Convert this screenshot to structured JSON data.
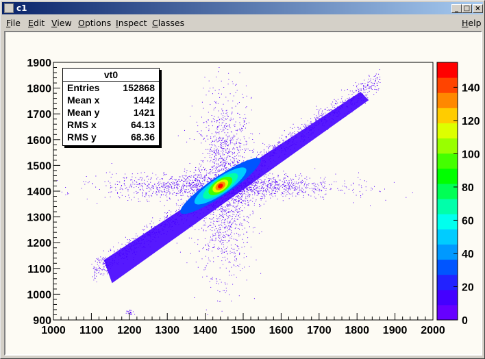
{
  "window": {
    "title": "c1",
    "buttons": {
      "minimize": "_",
      "maximize": "□",
      "close": "×"
    }
  },
  "menu": {
    "items": [
      "File",
      "Edit",
      "View",
      "Options",
      "Inspect",
      "Classes"
    ],
    "help": "Help"
  },
  "stats": {
    "title": "vt0",
    "rows": [
      {
        "label": "Entries",
        "value": "152868"
      },
      {
        "label": "Mean x",
        "value": "1442"
      },
      {
        "label": "Mean y",
        "value": "1421"
      },
      {
        "label": "RMS x",
        "value": "64.13"
      },
      {
        "label": "RMS y",
        "value": "68.36"
      }
    ]
  },
  "colors": {
    "palette": [
      "#6600ff",
      "#4400ff",
      "#2222ff",
      "#0055ff",
      "#0099ff",
      "#00ccff",
      "#00ffee",
      "#00ffaa",
      "#00ff55",
      "#00ff00",
      "#44ff00",
      "#99ff00",
      "#ddff00",
      "#ffcc00",
      "#ff8800",
      "#ff4400",
      "#ff0000"
    ],
    "background": "#fdfbf4",
    "marker": "#5500ff"
  },
  "chart_data": {
    "type": "heatmap",
    "title": "",
    "xlabel": "",
    "ylabel": "",
    "xlim": [
      1000,
      2000
    ],
    "ylim": [
      900,
      1900
    ],
    "xticks": [
      1000,
      1100,
      1200,
      1300,
      1400,
      1500,
      1600,
      1700,
      1800,
      1900,
      2000
    ],
    "yticks": [
      900,
      1000,
      1100,
      1200,
      1300,
      1400,
      1500,
      1600,
      1700,
      1800,
      1900
    ],
    "zlim": [
      0,
      155
    ],
    "zticks": [
      0,
      20,
      40,
      60,
      80,
      100,
      120,
      140
    ],
    "description_of_distribution": {
      "diagonal_band": {
        "from": [
          1140,
          1110
        ],
        "to": [
          1820,
          1780
        ],
        "peak_at": [
          1440,
          1420
        ],
        "peak_value": 150
      },
      "vertical_halo_x": 1450,
      "horizontal_halo_y": 1420
    },
    "grid": false,
    "legend": "right colorbar"
  }
}
